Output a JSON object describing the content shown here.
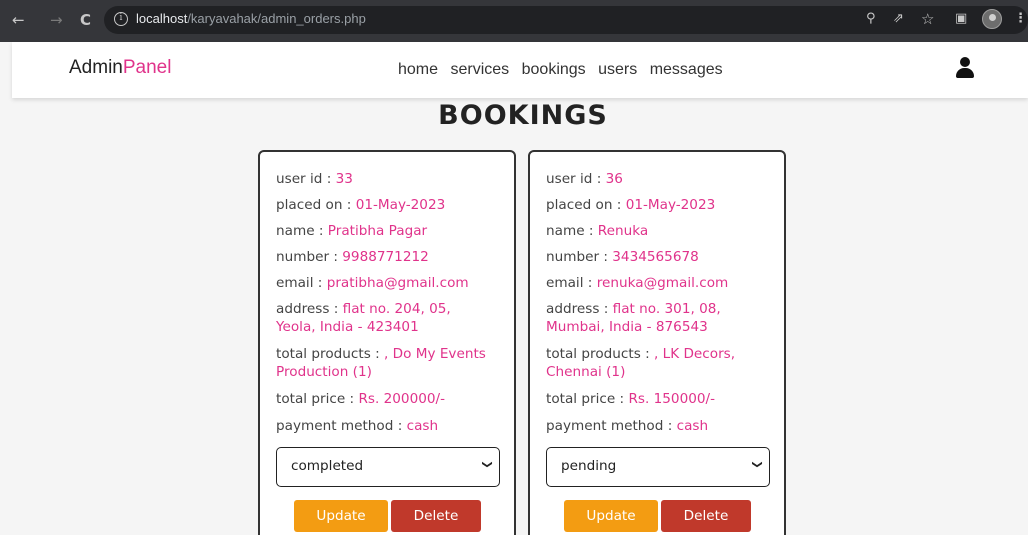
{
  "browser": {
    "url_host": "localhost",
    "url_path": "/karyavahak/admin_orders.php"
  },
  "header": {
    "logo_main": "Admin",
    "logo_accent": "Panel",
    "nav": [
      "home",
      "services",
      "bookings",
      "users",
      "messages"
    ]
  },
  "page_title": "BOOKINGS",
  "labels": {
    "user_id": "user id : ",
    "placed_on": "placed on : ",
    "name": "name : ",
    "number": "number : ",
    "email": "email : ",
    "address": "address : ",
    "total_products": "total products : ",
    "total_price": "total price : ",
    "payment_method": "payment method : ",
    "update": "Update",
    "delete": "Delete"
  },
  "orders": [
    {
      "user_id": "33",
      "placed_on": "01-May-2023",
      "name": "Pratibha Pagar",
      "number": "9988771212",
      "email": "pratibha@gmail.com",
      "address": "flat no. 204, 05, Yeola, India - 423401",
      "total_products": ", Do My Events Production (1)",
      "total_price": "Rs. 200000/-",
      "payment_method": "cash",
      "status": "completed"
    },
    {
      "user_id": "36",
      "placed_on": "01-May-2023",
      "name": "Renuka",
      "number": "3434565678",
      "email": "renuka@gmail.com",
      "address": "flat no. 301, 08, Mumbai, India - 876543",
      "total_products": ", LK Decors, Chennai (1)",
      "total_price": "Rs. 150000/-",
      "payment_method": "cash",
      "status": "pending"
    }
  ],
  "colors": {
    "accent": "#e0338b",
    "update_button": "#f39c12",
    "delete_button": "#c0392b"
  }
}
